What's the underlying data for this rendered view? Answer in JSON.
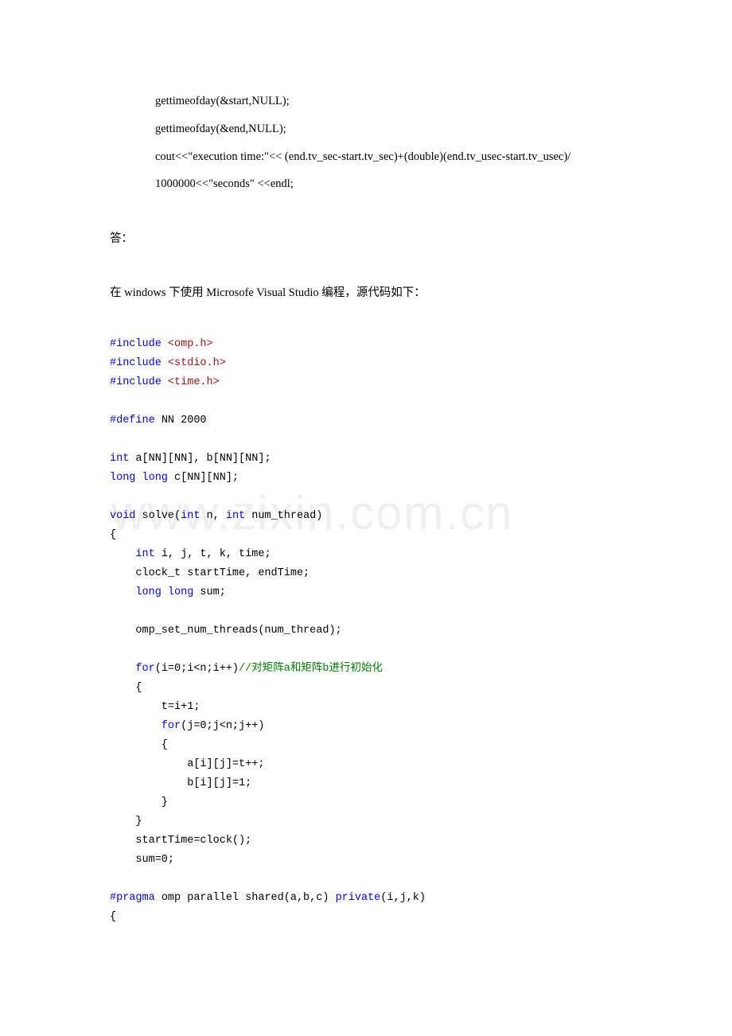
{
  "top_block": {
    "line1": "gettimeofday(&start,NULL);",
    "line2": "gettimeofday(&end,NULL);",
    "line3": "cout<<\"execution   time:\"<<   (end.tv_sec-start.tv_sec)+(double)(end.tv_usec-start.tv_usec)/",
    "line4": "1000000<<\"seconds\" <<endl;"
  },
  "answer_label": "答：",
  "context_line": "在 windows 下使用 Microsofe Visual Studio 编程，源代码如下：",
  "watermark": "www.zixin.com.cn",
  "code": {
    "inc1a": "#include",
    "inc1b": " <omp.h>",
    "inc2a": "#include",
    "inc2b": " <stdio.h>",
    "inc3a": "#include",
    "inc3b": " <time.h>",
    "def1a": "#define",
    "def1b": " NN 2000",
    "decl1a": "int",
    "decl1b": " a[NN][NN], b[NN][NN];",
    "decl2a": "long",
    "decl2b": " long",
    "decl2c": " c[NN][NN];",
    "fn1a": "void",
    "fn1b": " solve(",
    "fn1c": "int",
    "fn1d": " n, ",
    "fn1e": "int",
    "fn1f": " num_thread)",
    "ob": "{",
    "v1a": "    int",
    "v1b": " i, j, t, k, time;",
    "v2": "    clock_t startTime, endTime;",
    "v3a": "    long",
    "v3b": " long",
    "v3c": " sum;",
    "s1": "    omp_set_num_threads(num_thread);",
    "f1a": "    for",
    "f1b": "(i=0;i<n;i++)",
    "f1c": "//对矩阵a和矩阵b进行初始化",
    "ob2": "    {",
    "f2": "        t=i+1;",
    "f3a": "        for",
    "f3b": "(j=0;j<n;j++)",
    "ob3": "        {",
    "f4": "            a[i][j]=t++;",
    "f5": "            b[i][j]=1;",
    "cb3": "        }",
    "cb2": "    }",
    "s2": "    startTime=clock();",
    "s3": "    sum=0;",
    "pr1a": "#pragma",
    "pr1b": " omp parallel shared(a,b,c) ",
    "pr1c": "private",
    "pr1d": "(i,j,k)",
    "ob4": "{"
  }
}
